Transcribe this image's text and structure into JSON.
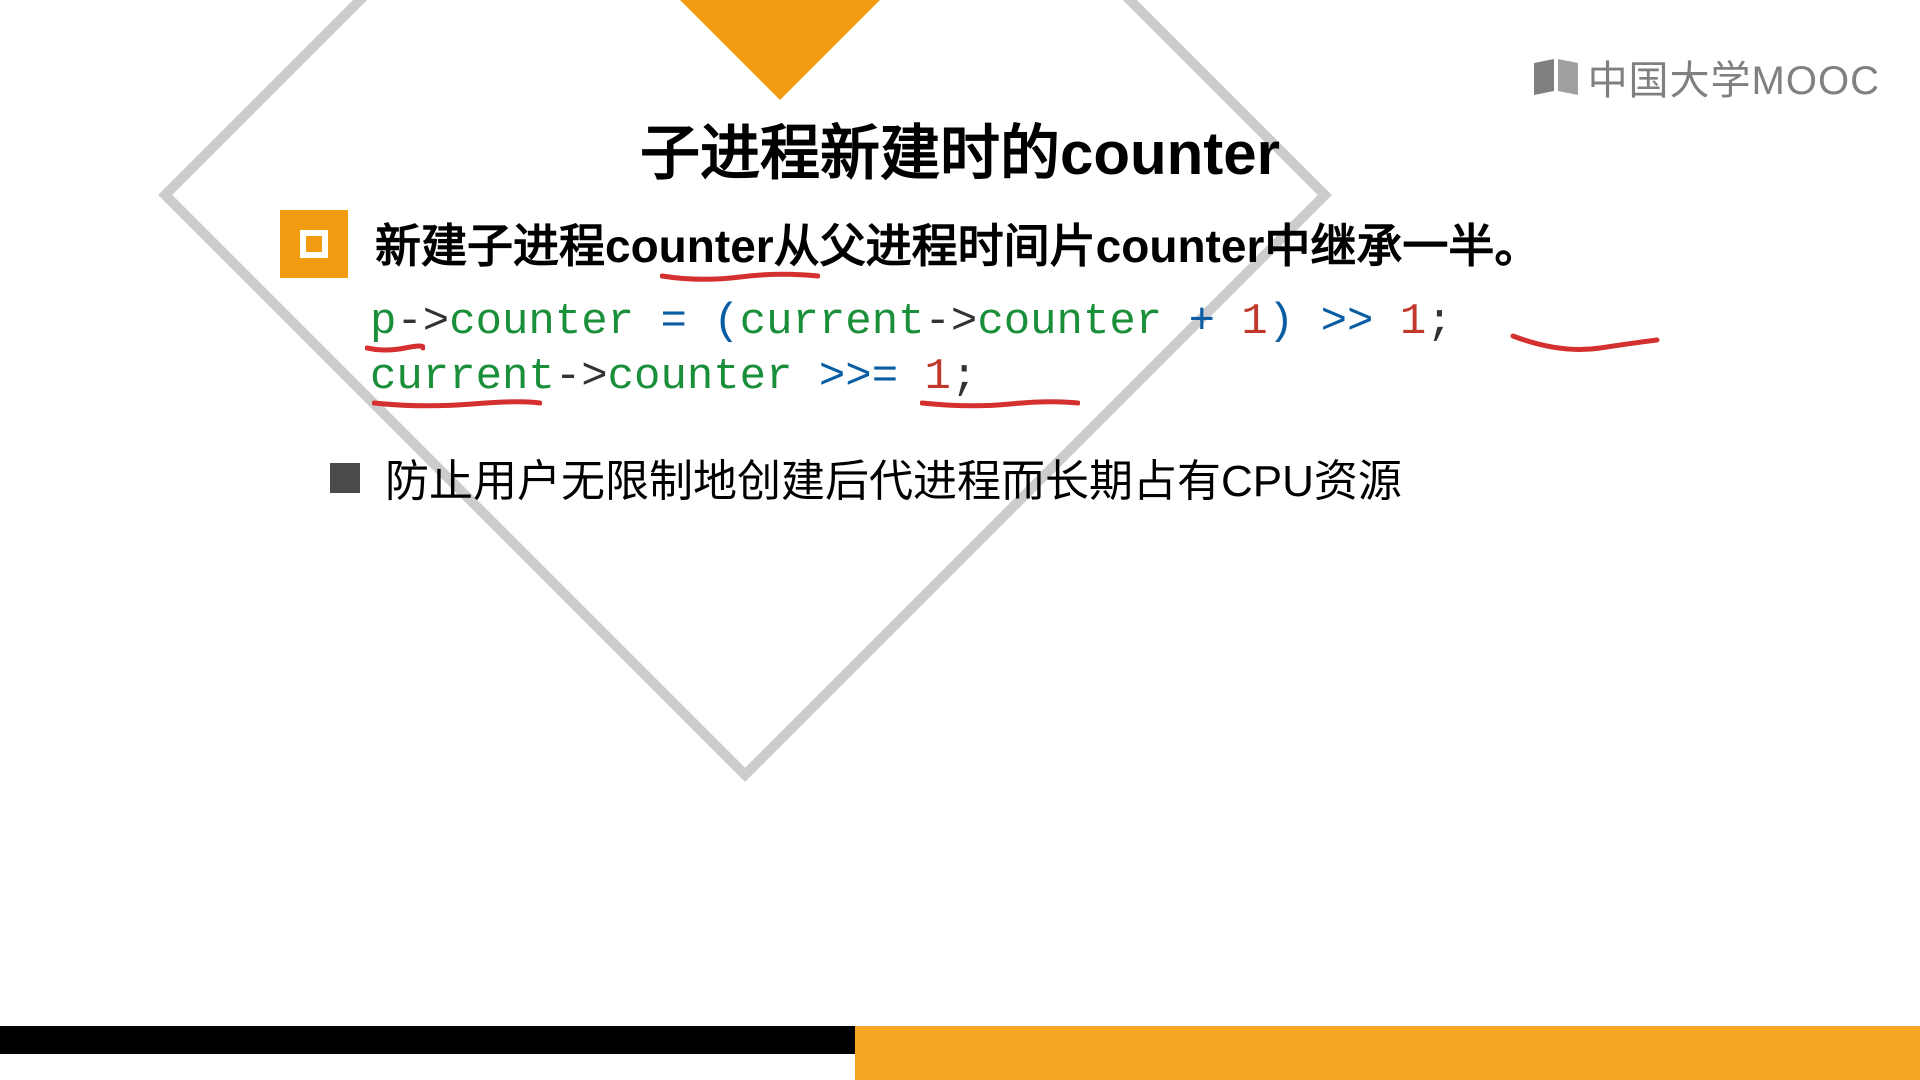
{
  "logo": {
    "text": "中国大学MOOC"
  },
  "title": "子进程新建时的counter",
  "bullet_main": "新建子进程counter从父进程时间片counter中继承一半。",
  "code": {
    "line1": {
      "p": "p",
      "arrow1": "->",
      "counter1": "counter",
      "eq": " = (",
      "current": "current",
      "arrow2": "->",
      "counter2": "counter",
      "plus": " + ",
      "one1": "1",
      "paren": ") ",
      "shift": ">>",
      "sp": " ",
      "one2": "1",
      "semi": ";"
    },
    "line2": {
      "current": "current",
      "arrow": "->",
      "counter": "counter",
      "shifteq": " >>= ",
      "one": "1",
      "semi": ";"
    }
  },
  "bullet_sub": "防止用户无限制地创建后代进程而长期占有CPU资源"
}
